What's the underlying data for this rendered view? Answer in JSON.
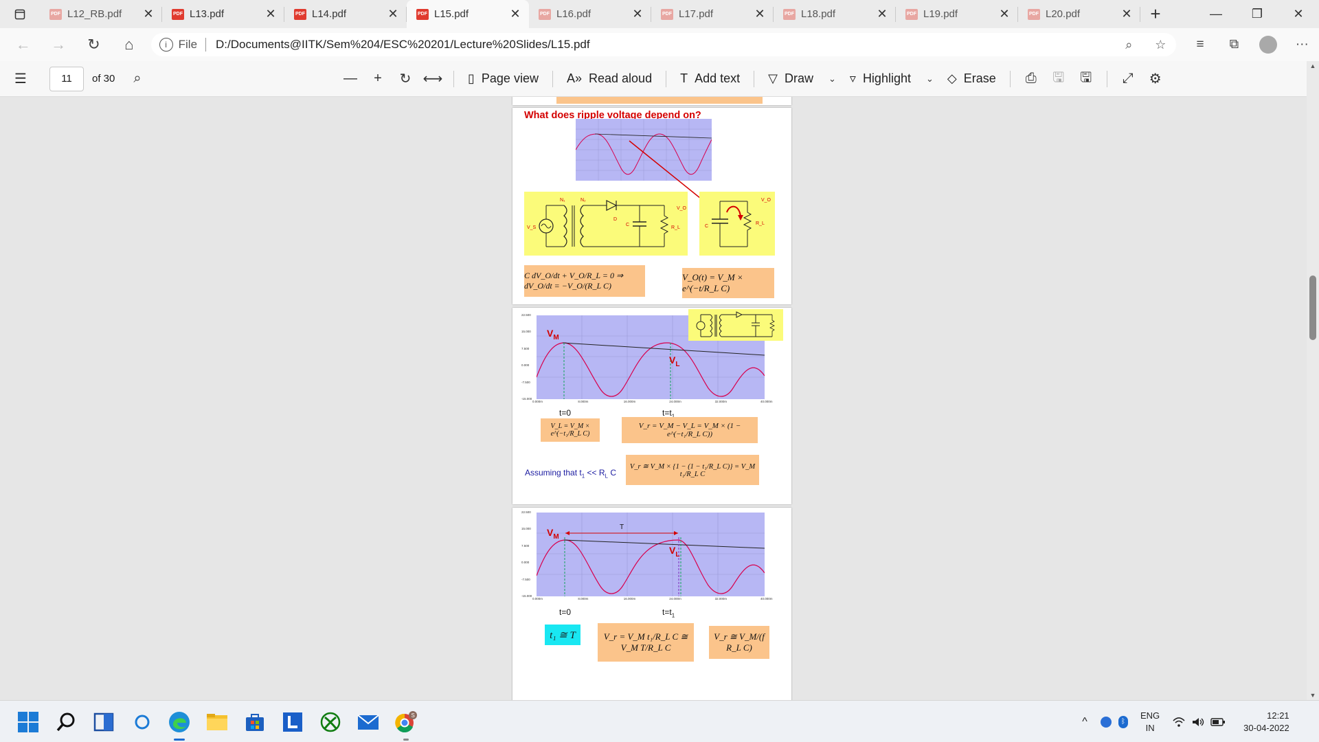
{
  "tabs": [
    {
      "label": "L12_RB.pdf",
      "active": false
    },
    {
      "label": "L13.pdf",
      "active": false
    },
    {
      "label": "L14.pdf",
      "active": false
    },
    {
      "label": "L15.pdf",
      "active": true
    },
    {
      "label": "L16.pdf",
      "active": false
    },
    {
      "label": "L17.pdf",
      "active": false
    },
    {
      "label": "L18.pdf",
      "active": false
    },
    {
      "label": "L19.pdf",
      "active": false
    },
    {
      "label": "L20.pdf",
      "active": false
    }
  ],
  "icons": {
    "pdf": "PDF",
    "close": "✕",
    "new_tab": "+",
    "minimize": "—",
    "restore": "❐",
    "window_close": "✕",
    "back": "←",
    "forward": "→",
    "refresh": "↻",
    "home": "⌂",
    "info": "i",
    "zoom": "⌕",
    "favorite": "☆",
    "favorites": "≡",
    "collections": "⧉",
    "more": "···",
    "contents": "☰",
    "search": "⌕",
    "zoom_out": "—",
    "zoom_in": "+",
    "rotate": "↻",
    "fit": "⟷",
    "page_view": "▯",
    "read_aloud": "A»",
    "add_text": "T",
    "draw": "▽",
    "highlight": "▿",
    "erase": "◇",
    "dropdown": "⌄",
    "print": "⎙",
    "save": "🖫",
    "save_as": "🖫",
    "fullscreen": "⤢",
    "settings": "⚙"
  },
  "address": {
    "scheme": "File",
    "url": "D:/Documents@IITK/Sem%204/ESC%20201/Lecture%20Slides/L15.pdf"
  },
  "pdf_toolbar": {
    "page_number": "11",
    "page_total": "of 30",
    "page_view": "Page view",
    "read_aloud": "Read aloud",
    "add_text": "Add text",
    "draw": "Draw",
    "highlight": "Highlight",
    "erase": "Erase"
  },
  "slide1": {
    "title": "What does ripple voltage depend on?",
    "labels": {
      "n1": "N₁",
      "n2": "N₂",
      "d": "D",
      "c": "C",
      "rl": "R_L",
      "vo": "V_O",
      "vs": "V_S",
      "c2": "C",
      "rl2": "R_L",
      "vo2": "V_O"
    },
    "eq1": "C dV_O/dt + V_O/R_L = 0 ⇒ dV_O/dt = −V_O/(R_L C)",
    "eq2": "V_O(t) = V_M × e^(−t/R_L C)"
  },
  "slide2": {
    "y_ticks": [
      "22.500",
      "15.000",
      "7.500",
      "0.000",
      "-7.500",
      "-15.000"
    ],
    "x_ticks": [
      "0.000m",
      "8.000m",
      "16.000m",
      "24.000m",
      "32.000m",
      "40.000m"
    ],
    "vm": "V",
    "vm_sub": "M",
    "vl": "V",
    "vl_sub": "L",
    "t0": "t=0",
    "t1": "t=t",
    "t1_sub": "1",
    "eq_vl": "V_L = V_M × e^(−t₁/R_L C)",
    "eq_vr": "V_r = V_M − V_L = V_M × (1 − e^(−t₁/R_L C))",
    "assume": "Assuming that t",
    "assume_sub": "1",
    "assume_tail": " << R",
    "assume_sub2": "L",
    "assume_end": " C",
    "eq_approx": "V_r ≅ V_M × {1 − (1 − t₁/R_L C)} = V_M t₁/R_L C"
  },
  "slide3": {
    "y_ticks": [
      "22.500",
      "15.000",
      "7.500",
      "0.000",
      "-7.500",
      "-15.000"
    ],
    "x_ticks": [
      "0.000m",
      "8.000m",
      "16.000m",
      "24.000m",
      "32.000m",
      "40.000m"
    ],
    "period": "T",
    "vm": "V",
    "vm_sub": "M",
    "vl": "V",
    "vl_sub": "L",
    "t0": "t=0",
    "t1": "t=t",
    "t1_sub": "1",
    "eq_t": "t₁ ≅ T",
    "eq_vr1": "V_r = V_M t₁/R_L C ≅ V_M T/R_L C",
    "eq_vr2": "V_r ≅ V_M/(f R_L C)"
  },
  "tray": {
    "lang": "ENG",
    "region": "IN",
    "time": "12:21",
    "date": "30-04-2022",
    "caret": "^",
    "wifi": "wifi",
    "volume": "volume",
    "battery": "battery"
  }
}
